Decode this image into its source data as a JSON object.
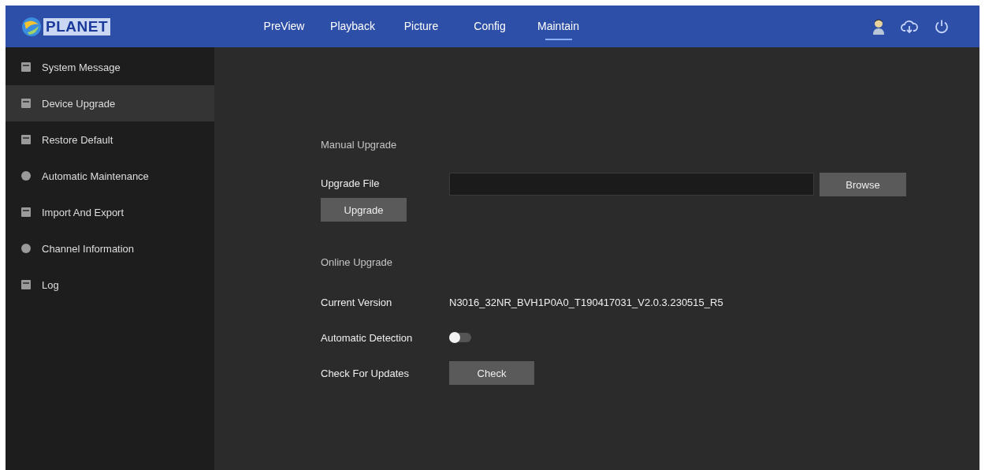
{
  "header": {
    "logo": "PLANET",
    "nav": [
      {
        "label": "PreView",
        "selected": false
      },
      {
        "label": "Playback",
        "selected": false
      },
      {
        "label": "Picture",
        "selected": false
      },
      {
        "label": "Config",
        "selected": false
      },
      {
        "label": "Maintain",
        "selected": true
      }
    ]
  },
  "sidebar": {
    "items": [
      {
        "label": "System Message",
        "selected": false
      },
      {
        "label": "Device Upgrade",
        "selected": true
      },
      {
        "label": "Restore Default",
        "selected": false
      },
      {
        "label": "Automatic Maintenance",
        "selected": false
      },
      {
        "label": "Import And Export",
        "selected": false
      },
      {
        "label": "Channel Information",
        "selected": false
      },
      {
        "label": "Log",
        "selected": false
      }
    ]
  },
  "manual_upgrade": {
    "title": "Manual Upgrade",
    "file_label": "Upgrade File",
    "browse_button": "Browse",
    "upgrade_button": "Upgrade"
  },
  "online_upgrade": {
    "title": "Online Upgrade",
    "current_version_label": "Current Version",
    "current_version": "N3016_32NR_BVH1P0A0_T190417031_V2.0.3.230515_R5",
    "auto_detection_label": "Automatic Detection",
    "auto_detection_on": false,
    "check_label": "Check For Updates",
    "check_button": "Check"
  }
}
